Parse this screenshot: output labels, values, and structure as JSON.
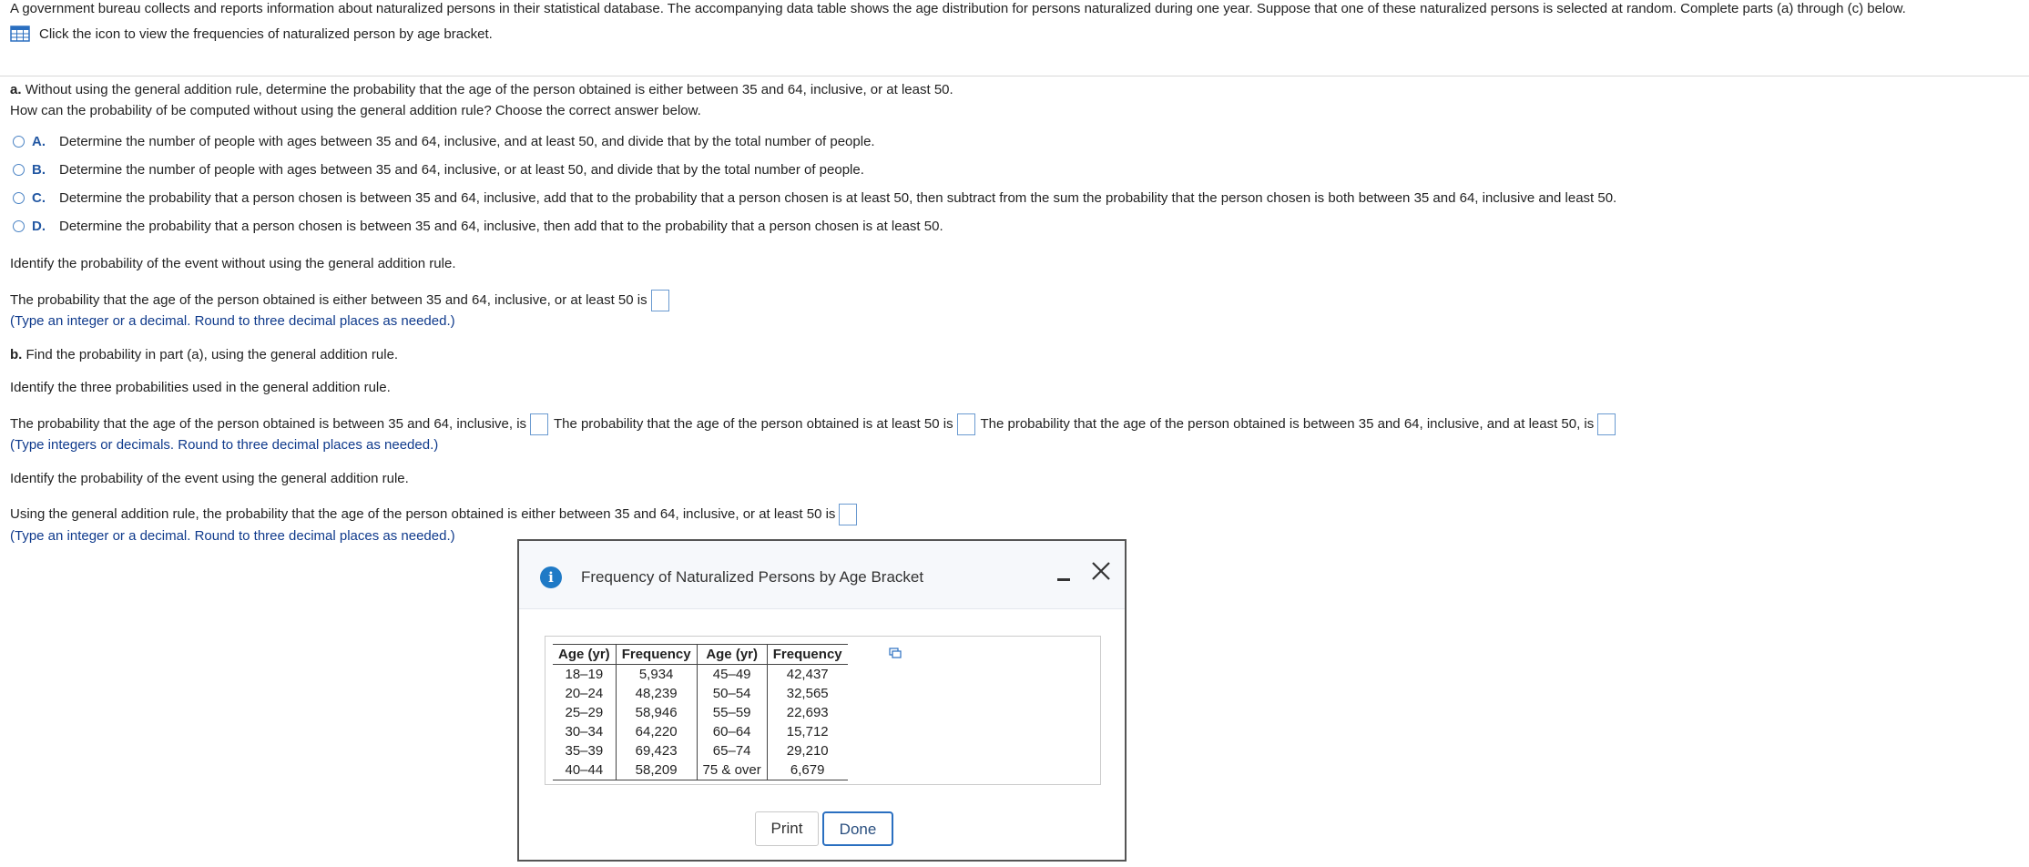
{
  "intro": {
    "text": "A government bureau collects and reports information about naturalized persons in their statistical database. The accompanying data table shows the age distribution for persons naturalized during one year. Suppose that one of these naturalized persons is selected at random. Complete parts (a) through (c) below.",
    "icon_link": "Click the icon to view the frequencies of naturalized person by age bracket."
  },
  "part_a": {
    "label": "a.",
    "question": "Without using the general addition rule, determine the probability that the age of the person obtained is either between 35 and 64, inclusive, or at least 50.",
    "subquestion": "How can the probability of be computed without using the general addition rule? Choose the correct answer below.",
    "choices": [
      {
        "letter": "A.",
        "text": "Determine the number of people with ages between 35 and 64, inclusive, and at least 50, and divide that by the total number of people."
      },
      {
        "letter": "B.",
        "text": "Determine the number of people with ages between 35 and 64, inclusive, or at least 50, and divide that by the total number of people."
      },
      {
        "letter": "C.",
        "text": "Determine the probability that a person chosen is between 35 and 64, inclusive, add that to the probability that a person chosen is at least 50, then subtract from the sum the probability that the person chosen is both between 35 and 64, inclusive and least 50."
      },
      {
        "letter": "D.",
        "text": "Determine the probability that a person chosen is between 35 and 64, inclusive, then add that to the probability that a person chosen is at least 50."
      }
    ],
    "identify": "Identify the probability of the event without using the general addition rule.",
    "answer_prompt": "The probability that the age of the person obtained is either between 35 and 64, inclusive, or at least 50 is",
    "hint": "(Type an integer or a decimal. Round to three decimal places as needed.)"
  },
  "part_b": {
    "label": "b.",
    "question": "Find the probability in part (a), using the general addition rule.",
    "identify_three": "Identify the three probabilities used in the general addition rule.",
    "prob1": "The probability that the age of the person obtained is between 35 and 64, inclusive, is",
    "prob2": "The probability that the age of the person obtained is at least 50 is",
    "prob3": "The probability that the age of the person obtained is between 35 and 64, inclusive, and at least 50, is",
    "hint1": "(Type integers or decimals. Round to three decimal places as needed.)",
    "identify_event": "Identify the probability of the event using the general addition rule.",
    "answer_prompt": "Using the general addition rule, the probability that the age of the person obtained is either between 35 and 64, inclusive, or at least 50 is",
    "hint2": "(Type an integer or a decimal. Round to three decimal places as needed.)"
  },
  "dialog": {
    "title": "Frequency of Naturalized Persons by Age Bracket",
    "headers": [
      "Age (yr)",
      "Frequency",
      "Age (yr)",
      "Frequency"
    ],
    "rows": [
      [
        "18–19",
        "5,934",
        "45–49",
        "42,437"
      ],
      [
        "20–24",
        "48,239",
        "50–54",
        "32,565"
      ],
      [
        "25–29",
        "58,946",
        "55–59",
        "22,693"
      ],
      [
        "30–34",
        "64,220",
        "60–64",
        "15,712"
      ],
      [
        "35–39",
        "69,423",
        "65–74",
        "29,210"
      ],
      [
        "40–44",
        "58,209",
        "75 & over",
        "6,679"
      ]
    ],
    "print_label": "Print",
    "done_label": "Done"
  },
  "icons": {
    "table": "table-icon",
    "info": "info-icon",
    "minimize": "minimize-icon",
    "close": "close-icon",
    "copy": "copy-icon"
  },
  "colors": {
    "accent": "#2a6fc0",
    "hint_text": "#0f3a8c",
    "choice_letter": "#2358a3",
    "info_icon": "#1f7ac6"
  }
}
